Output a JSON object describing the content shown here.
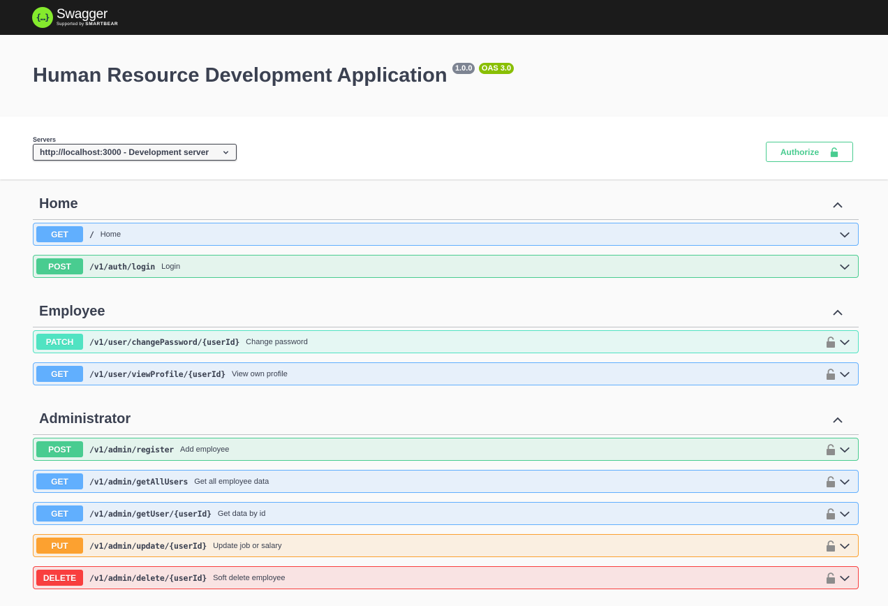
{
  "topbar": {
    "logo_glyph": "{…}",
    "brand": "Swagger",
    "supported_by": "Supported by",
    "company": "SMARTBEAR"
  },
  "info": {
    "title": "Human Resource Development Application",
    "version": "1.0.0",
    "oas": "OAS 3.0"
  },
  "servers": {
    "label": "Servers",
    "selected": "http://localhost:3000 - Development server"
  },
  "authorize": {
    "label": "Authorize"
  },
  "colors": {
    "get": "#61affe",
    "post": "#49cc90",
    "patch": "#50e3c2",
    "put": "#fca130",
    "delete": "#f93e3e"
  },
  "sections": [
    {
      "name": "Home",
      "operations": [
        {
          "method": "GET",
          "path": "/",
          "summary": "Home"
        },
        {
          "method": "POST",
          "path": "/v1/auth/login",
          "summary": "Login"
        }
      ]
    },
    {
      "name": "Employee",
      "operations": [
        {
          "method": "PATCH",
          "path": "/v1/user/changePassword/{userId}",
          "summary": "Change password"
        },
        {
          "method": "GET",
          "path": "/v1/user/viewProfile/{userId}",
          "summary": "View own profile"
        }
      ]
    },
    {
      "name": "Administrator",
      "operations": [
        {
          "method": "POST",
          "path": "/v1/admin/register",
          "summary": "Add employee"
        },
        {
          "method": "GET",
          "path": "/v1/admin/getAllUsers",
          "summary": "Get all employee data"
        },
        {
          "method": "GET",
          "path": "/v1/admin/getUser/{userId}",
          "summary": "Get data by id"
        },
        {
          "method": "PUT",
          "path": "/v1/admin/update/{userId}",
          "summary": "Update job or salary"
        },
        {
          "method": "DELETE",
          "path": "/v1/admin/delete/{userId}",
          "summary": "Soft delete employee"
        }
      ]
    }
  ]
}
